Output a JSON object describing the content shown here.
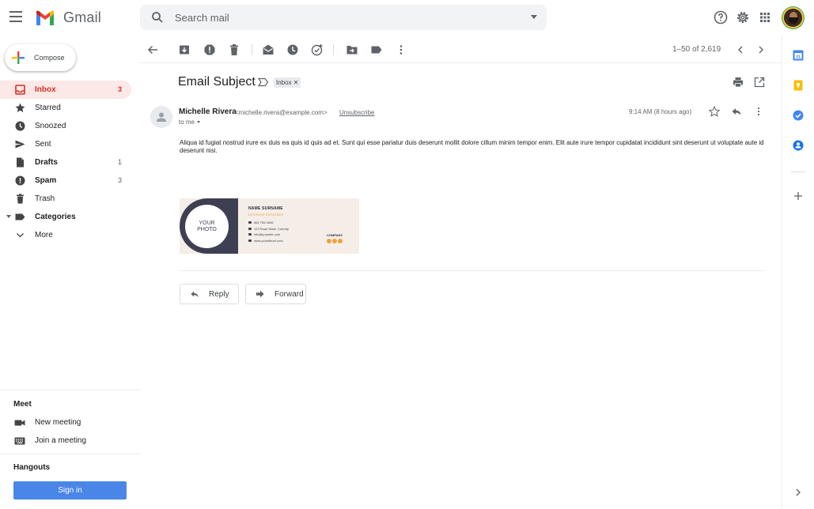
{
  "header": {
    "app_name": "Gmail",
    "search_placeholder": "Search mail"
  },
  "sidebar": {
    "compose_label": "Compose",
    "items": [
      {
        "label": "Inbox",
        "count": "3",
        "icon": "inbox-icon"
      },
      {
        "label": "Starred",
        "count": "",
        "icon": "star-icon"
      },
      {
        "label": "Snoozed",
        "count": "",
        "icon": "clock-icon"
      },
      {
        "label": "Sent",
        "count": "",
        "icon": "send-icon"
      },
      {
        "label": "Drafts",
        "count": "1",
        "icon": "draft-icon"
      },
      {
        "label": "Spam",
        "count": "3",
        "icon": "spam-icon"
      },
      {
        "label": "Trash",
        "count": "",
        "icon": "trash-icon"
      },
      {
        "label": "Categories",
        "count": "",
        "icon": "label-icon"
      },
      {
        "label": "More",
        "count": "",
        "icon": "chevron-down-icon"
      }
    ],
    "meet": {
      "title": "Meet",
      "new_meeting": "New meeting",
      "join_meeting": "Join a meeting"
    },
    "hangouts": {
      "title": "Hangouts",
      "sign_in": "Sign in"
    }
  },
  "toolbar": {
    "pager": "1–50 of 2,619"
  },
  "message": {
    "subject": "Email Subject",
    "label": "Inbox",
    "sender_name": "Michelle Rivera",
    "sender_email": "<michelle.rivera@example.com>",
    "unsubscribe": "Unsubscribe",
    "to": "to me",
    "time": "9:14 AM (8 hours ago)",
    "body": "Aliqua id fugiat nostrud irure ex duis ea quis id quis ad et. Sunt qui esse pariatur duis deserunt mollit dolore cillum minim tempor enim. Elit aute irure tempor cupidatat incididunt sint deserunt ut voluptate aute id deserunt nisi.",
    "signature": {
      "photo_text_1": "YOUR",
      "photo_text_2": "PHOTO",
      "name": "NAME SURNAME",
      "title": "INTERIOR DESIGNER",
      "phone": "682 755 4546",
      "address": "123 Road State, Country",
      "email": "info@yoursite.com",
      "website": "www.yoursiteurl.com",
      "company": "COMPANY"
    },
    "reply_label": "Reply",
    "forward_label": "Forward"
  },
  "colors": {
    "accent_red": "#d93025",
    "active_bg": "#fce8e6",
    "sign_in_blue": "#4a86e8"
  }
}
